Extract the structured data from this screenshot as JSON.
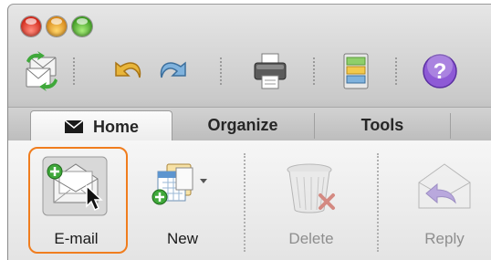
{
  "window": {
    "traffic_lights": [
      "close",
      "minimize",
      "zoom"
    ]
  },
  "toolbar": {
    "buttons": [
      {
        "icon": "send-receive-icon"
      },
      {
        "icon": "undo-icon"
      },
      {
        "icon": "redo-icon"
      },
      {
        "icon": "print-icon"
      },
      {
        "icon": "toolbox-icon"
      },
      {
        "icon": "help-icon"
      }
    ]
  },
  "tabs": [
    {
      "label": "Home",
      "active": true,
      "icon": "envelope-icon"
    },
    {
      "label": "Organize",
      "active": false
    },
    {
      "label": "Tools",
      "active": false
    }
  ],
  "ribbon": {
    "buttons": [
      {
        "label": "E-mail",
        "enabled": true,
        "highlighted": true,
        "icon": "new-email-icon"
      },
      {
        "label": "New",
        "enabled": true,
        "icon": "new-item-icon"
      },
      {
        "label": "Delete",
        "enabled": false,
        "icon": "delete-icon"
      },
      {
        "label": "Reply",
        "enabled": false,
        "icon": "reply-icon"
      }
    ]
  },
  "colors": {
    "highlight": "#f07d1e",
    "enabled_label": "#1a1a1a",
    "disabled_label": "#8e8e8e"
  }
}
